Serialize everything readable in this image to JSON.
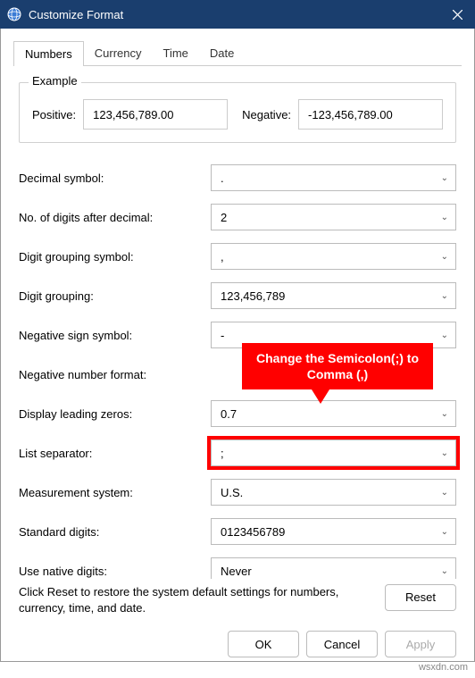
{
  "window": {
    "title": "Customize Format"
  },
  "tabs": {
    "numbers": "Numbers",
    "currency": "Currency",
    "time": "Time",
    "date": "Date"
  },
  "example": {
    "legend": "Example",
    "positive_label": "Positive:",
    "positive_value": "123,456,789.00",
    "negative_label": "Negative:",
    "negative_value": "-123,456,789.00"
  },
  "fields": {
    "decimal_symbol": {
      "label": "Decimal symbol:",
      "value": "."
    },
    "digits_after_decimal": {
      "label": "No. of digits after decimal:",
      "value": "2"
    },
    "grouping_symbol": {
      "label": "Digit grouping symbol:",
      "value": ","
    },
    "digit_grouping": {
      "label": "Digit grouping:",
      "value": "123,456,789"
    },
    "negative_sign": {
      "label": "Negative sign symbol:",
      "value": "-"
    },
    "negative_format": {
      "label": "Negative number format:",
      "value": ""
    },
    "leading_zeros": {
      "label": "Display leading zeros:",
      "value": "0.7"
    },
    "list_separator": {
      "label": "List separator:",
      "value": ";"
    },
    "measurement": {
      "label": "Measurement system:",
      "value": "U.S."
    },
    "standard_digits": {
      "label": "Standard digits:",
      "value": "0123456789"
    },
    "native_digits": {
      "label": "Use native digits:",
      "value": "Never"
    }
  },
  "callout": {
    "text": "Change the Semicolon(;) to Comma (,)"
  },
  "reset": {
    "text": "Click Reset to restore the system default settings for numbers, currency, time, and date.",
    "btn": "Reset"
  },
  "buttons": {
    "ok": "OK",
    "cancel": "Cancel",
    "apply": "Apply"
  },
  "watermark": "wsxdn.com"
}
